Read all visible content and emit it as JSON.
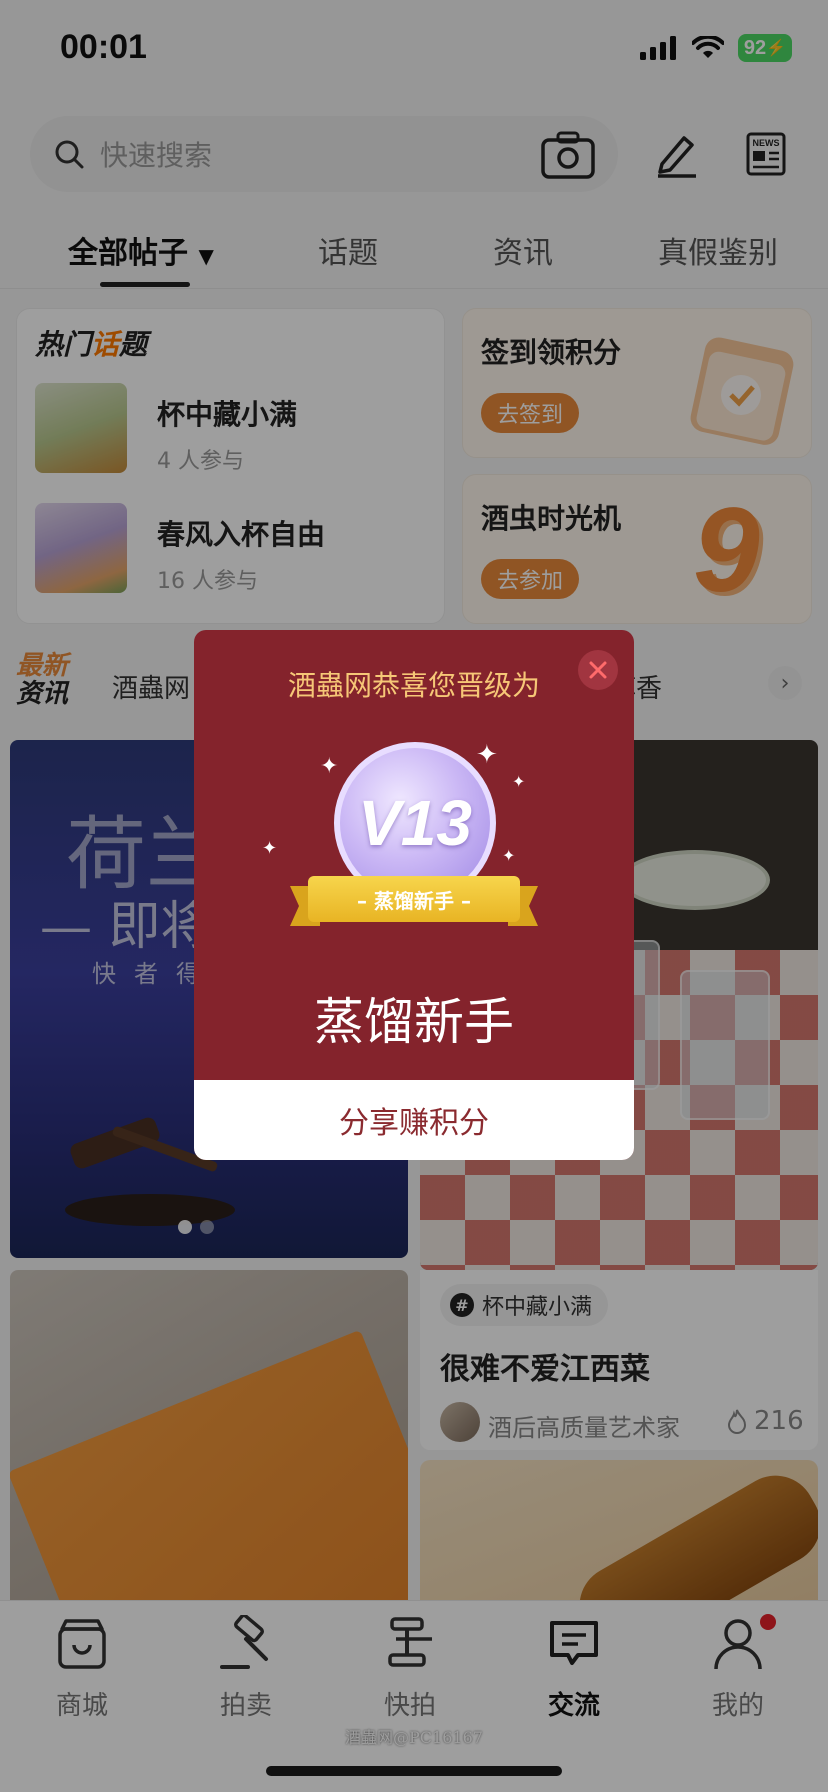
{
  "status_bar": {
    "time": "00:01",
    "battery": "92"
  },
  "search": {
    "placeholder": "快速搜索"
  },
  "tabs": [
    {
      "label": "全部帖子"
    },
    {
      "label": "话题"
    },
    {
      "label": "资讯"
    },
    {
      "label": "真假鉴别"
    }
  ],
  "hot_topics": {
    "title_a": "热门",
    "title_b": "话",
    "title_c": "题",
    "items": [
      {
        "name": "杯中藏小满",
        "count": "4 人参与"
      },
      {
        "name": "春风入杯自由",
        "count": "16 人参与"
      }
    ]
  },
  "checkin_card": {
    "title": "签到领积分",
    "button": "去签到"
  },
  "timemachine_card": {
    "title": "酒虫时光机",
    "button": "去参加"
  },
  "news": {
    "label_line1": "最新",
    "label_line2": "资讯",
    "ticker_left": "酒蟲网",
    "ticker_right": "醇香"
  },
  "feed": {
    "banner_big": "荷兰",
    "banner_mid": "— 即将",
    "banner_small": "快者得",
    "post": {
      "topic": "杯中藏小满",
      "title": "很难不爱江西菜",
      "author": "酒后高质量艺术家",
      "likes": "216"
    }
  },
  "modal": {
    "headline": "酒蟲网恭喜您晋级为",
    "badge_level": "V13",
    "ribbon": "– 蒸馏新手 –",
    "level_name": "蒸馏新手",
    "share_button": "分享赚积分"
  },
  "bottom_nav": [
    {
      "label": "商城",
      "icon": "shop-icon"
    },
    {
      "label": "拍卖",
      "icon": "gavel-icon"
    },
    {
      "label": "快拍",
      "icon": "quick-auction-icon"
    },
    {
      "label": "交流",
      "icon": "chat-icon",
      "active": true
    },
    {
      "label": "我的",
      "icon": "profile-icon"
    }
  ],
  "watermark": "酒蟲网@PC16167",
  "colors": {
    "modal_bg": "#84232c",
    "accent_orange": "#e8893a",
    "modal_headline": "#f6c777"
  }
}
